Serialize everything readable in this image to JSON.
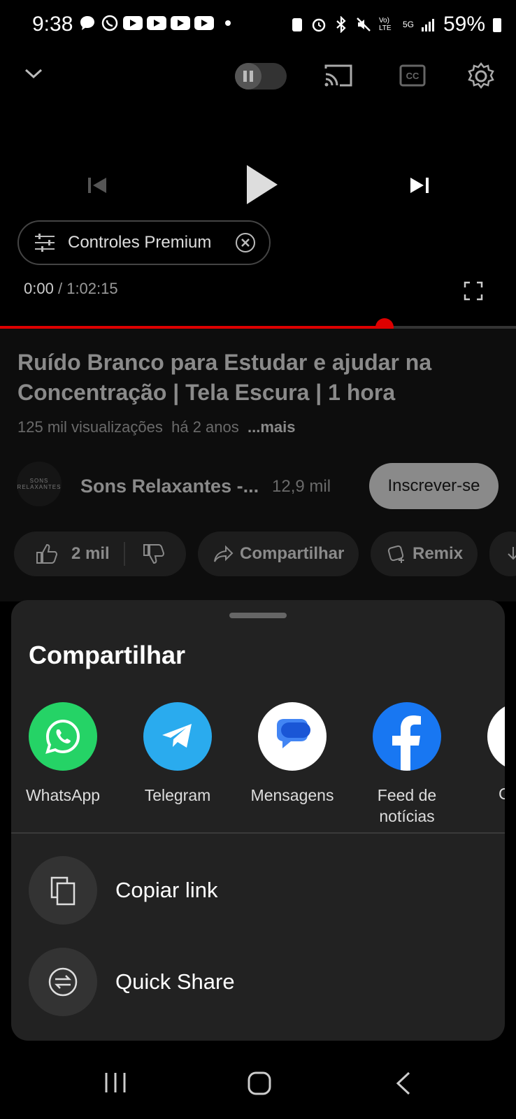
{
  "status_bar": {
    "time": "9:38",
    "battery": "59%",
    "network": "5G",
    "volte": "Vo) LTE"
  },
  "player": {
    "premium_label": "Controles Premium",
    "time_current": "0:00",
    "time_separator": "/",
    "time_total": "1:02:15",
    "progress_fraction": 0.745
  },
  "video": {
    "title": "Ruído Branco para Estudar e ajudar na Concentração | Tela Escura | 1 hora",
    "views": "125 mil visualizações",
    "age": "há 2 anos",
    "more": "...mais"
  },
  "channel": {
    "avatar_text_1": "SONS",
    "avatar_text_2": "RELAXANTES",
    "name": "Sons Relaxantes -...",
    "subs": "12,9 mil",
    "subscribe_label": "Inscrever-se"
  },
  "actions": {
    "likes": "2 mil",
    "share": "Compartilhar",
    "remix": "Remix"
  },
  "share_sheet": {
    "title": "Compartilhar",
    "apps": [
      {
        "label": "WhatsApp",
        "icon": "whatsapp-icon",
        "color": "#25D366"
      },
      {
        "label": "Telegram",
        "icon": "telegram-icon",
        "color": "#2AABEE"
      },
      {
        "label": "Mensagens",
        "icon": "messages-icon",
        "color": "#ffffff"
      },
      {
        "label_line1": "Feed de",
        "label_line2": "notícias",
        "icon": "facebook-icon",
        "color": "#1877F2"
      },
      {
        "label": "C",
        "icon": "partial-app-icon",
        "color": "#ffffff"
      }
    ],
    "copy_link": "Copiar link",
    "quick_share": "Quick Share"
  },
  "colors": {
    "accent_red": "#dd0000",
    "sheet_bg": "#222222"
  }
}
